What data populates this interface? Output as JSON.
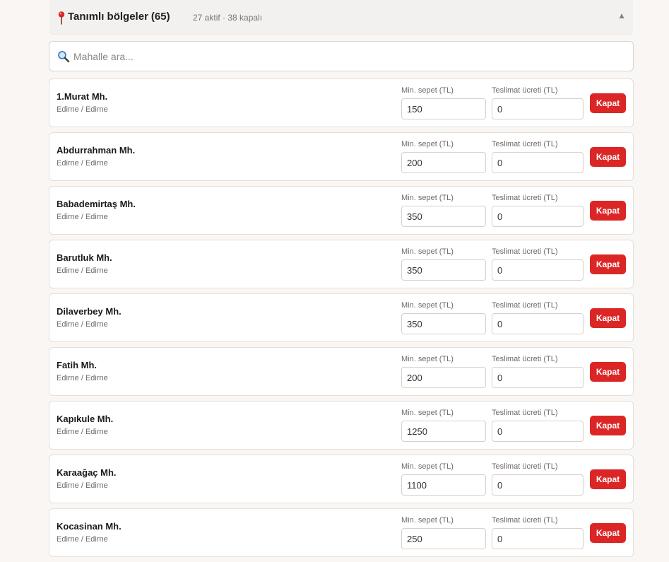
{
  "header": {
    "title": "Tanımlı bölgeler",
    "count": "(65)",
    "meta": "27 aktif · 38 kapalı",
    "collapse_icon": "▲"
  },
  "search": {
    "placeholder": "Mahalle ara..."
  },
  "labels": {
    "min_basket": "Min. sepet (TL)",
    "delivery_fee": "Teslimat ücreti (TL)",
    "close_button": "Kapat"
  },
  "colors": {
    "close_button": "#dc2626",
    "pin": "#dc2626"
  },
  "rows": [
    {
      "name": "1.Murat Mh.",
      "location": "Edirne / Edirne",
      "min_basket": "150",
      "delivery_fee": "0"
    },
    {
      "name": "Abdurrahman Mh.",
      "location": "Edirne / Edirne",
      "min_basket": "200",
      "delivery_fee": "0"
    },
    {
      "name": "Babademirtaş Mh.",
      "location": "Edirne / Edirne",
      "min_basket": "350",
      "delivery_fee": "0"
    },
    {
      "name": "Barutluk Mh.",
      "location": "Edirne / Edirne",
      "min_basket": "350",
      "delivery_fee": "0"
    },
    {
      "name": "Dilaverbey Mh.",
      "location": "Edirne / Edirne",
      "min_basket": "350",
      "delivery_fee": "0"
    },
    {
      "name": "Fatih Mh.",
      "location": "Edirne / Edirne",
      "min_basket": "200",
      "delivery_fee": "0"
    },
    {
      "name": "Kapıkule Mh.",
      "location": "Edirne / Edirne",
      "min_basket": "1250",
      "delivery_fee": "0"
    },
    {
      "name": "Karaağaç Mh.",
      "location": "Edirne / Edirne",
      "min_basket": "1100",
      "delivery_fee": "0"
    },
    {
      "name": "Kocasinan Mh.",
      "location": "Edirne / Edirne",
      "min_basket": "250",
      "delivery_fee": "0"
    }
  ]
}
